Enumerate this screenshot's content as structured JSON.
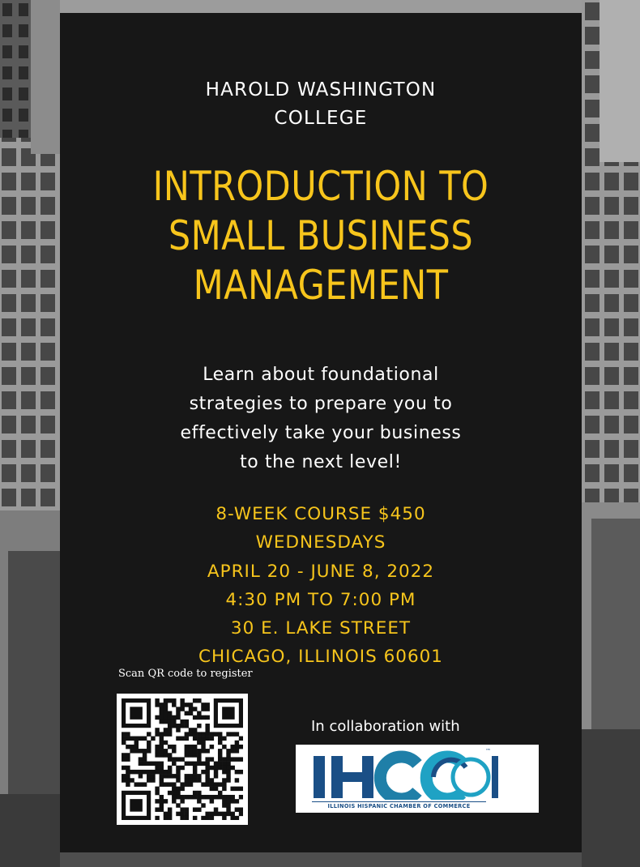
{
  "college": [
    "HAROLD WASHINGTON",
    "COLLEGE"
  ],
  "title": [
    "INTRODUCTION TO",
    "SMALL BUSINESS",
    "MANAGEMENT"
  ],
  "description": [
    "Learn about foundational",
    "strategies to prepare you to",
    "effectively take your business",
    "to the next level!"
  ],
  "details": [
    "8-WEEK COURSE $450",
    "WEDNESDAYS",
    "APRIL 20 - JUNE 8, 2022",
    "4:30 PM TO 7:00 PM",
    "30 E. LAKE STREET",
    "CHICAGO, ILLINOIS 60601"
  ],
  "qr": {
    "caption": "Scan QR code to register"
  },
  "collaboration": {
    "label": "In collaboration with",
    "logo_letters": "IHCC",
    "logo_tagline": "ILLINOIS HISPANIC CHAMBER OF COMMERCE",
    "logo_mark": "™"
  },
  "colors": {
    "accent": "#f7c51c",
    "panel": "#171717",
    "text": "#ffffff",
    "logo_blue": "#1a4f86",
    "logo_teal": "#1fa2c4"
  }
}
